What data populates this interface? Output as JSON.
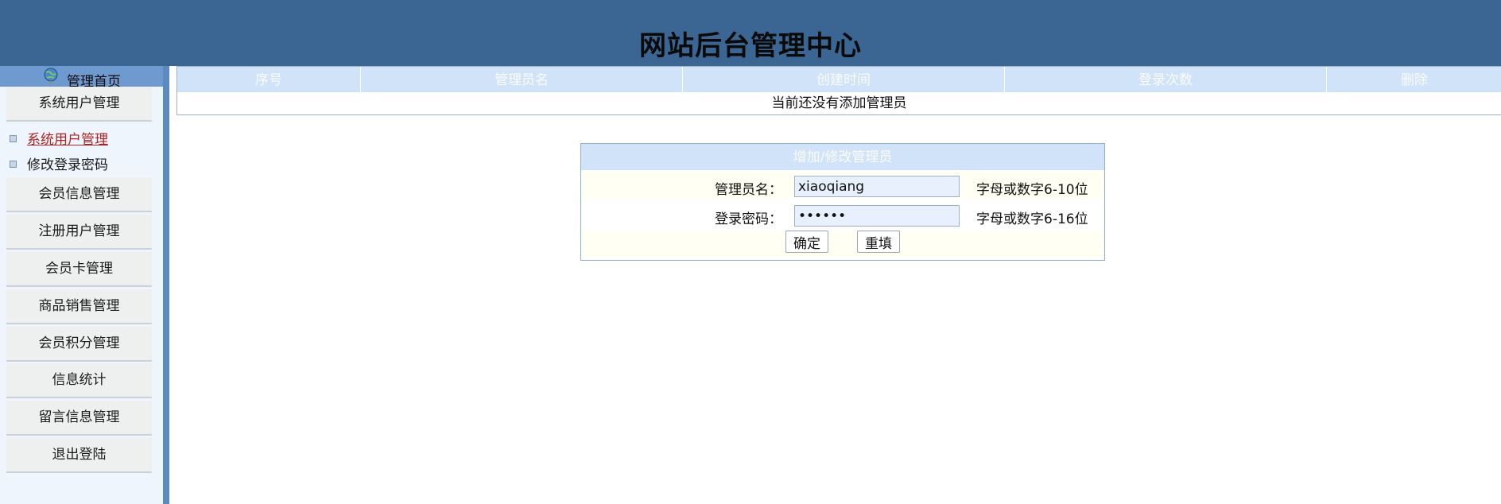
{
  "header": {
    "title": "网站后台管理中心"
  },
  "sidebar": {
    "home_label": "管理首页",
    "menu": [
      {
        "label": "系统用户管理"
      },
      {
        "label": "会员信息管理"
      },
      {
        "label": "注册用户管理"
      },
      {
        "label": "会员卡管理"
      },
      {
        "label": "商品销售管理"
      },
      {
        "label": "会员积分管理"
      },
      {
        "label": "信息统计"
      },
      {
        "label": "留言信息管理"
      },
      {
        "label": "退出登陆"
      }
    ],
    "submenu": [
      {
        "label": "系统用户管理",
        "active": true
      },
      {
        "label": "修改登录密码",
        "active": false
      }
    ]
  },
  "admin_table": {
    "columns": [
      "序号",
      "管理员名",
      "创建时间",
      "登录次数",
      "删除"
    ],
    "empty_text": "当前还没有添加管理员"
  },
  "form": {
    "title": "增加/修改管理员",
    "username_label": "管理员名：",
    "username_value": "xiaoqiang",
    "username_hint": "字母或数字6-10位",
    "password_label": "登录密码：",
    "password_value": "123456",
    "password_hint": "字母或数字6-16位",
    "submit_label": "确定",
    "reset_label": "重填"
  },
  "colors": {
    "header_bg": "#3b6592",
    "sidebar_bg": "#eef5fc",
    "table_header_bg": "#d0e3f8",
    "active_link": "#b22222"
  }
}
